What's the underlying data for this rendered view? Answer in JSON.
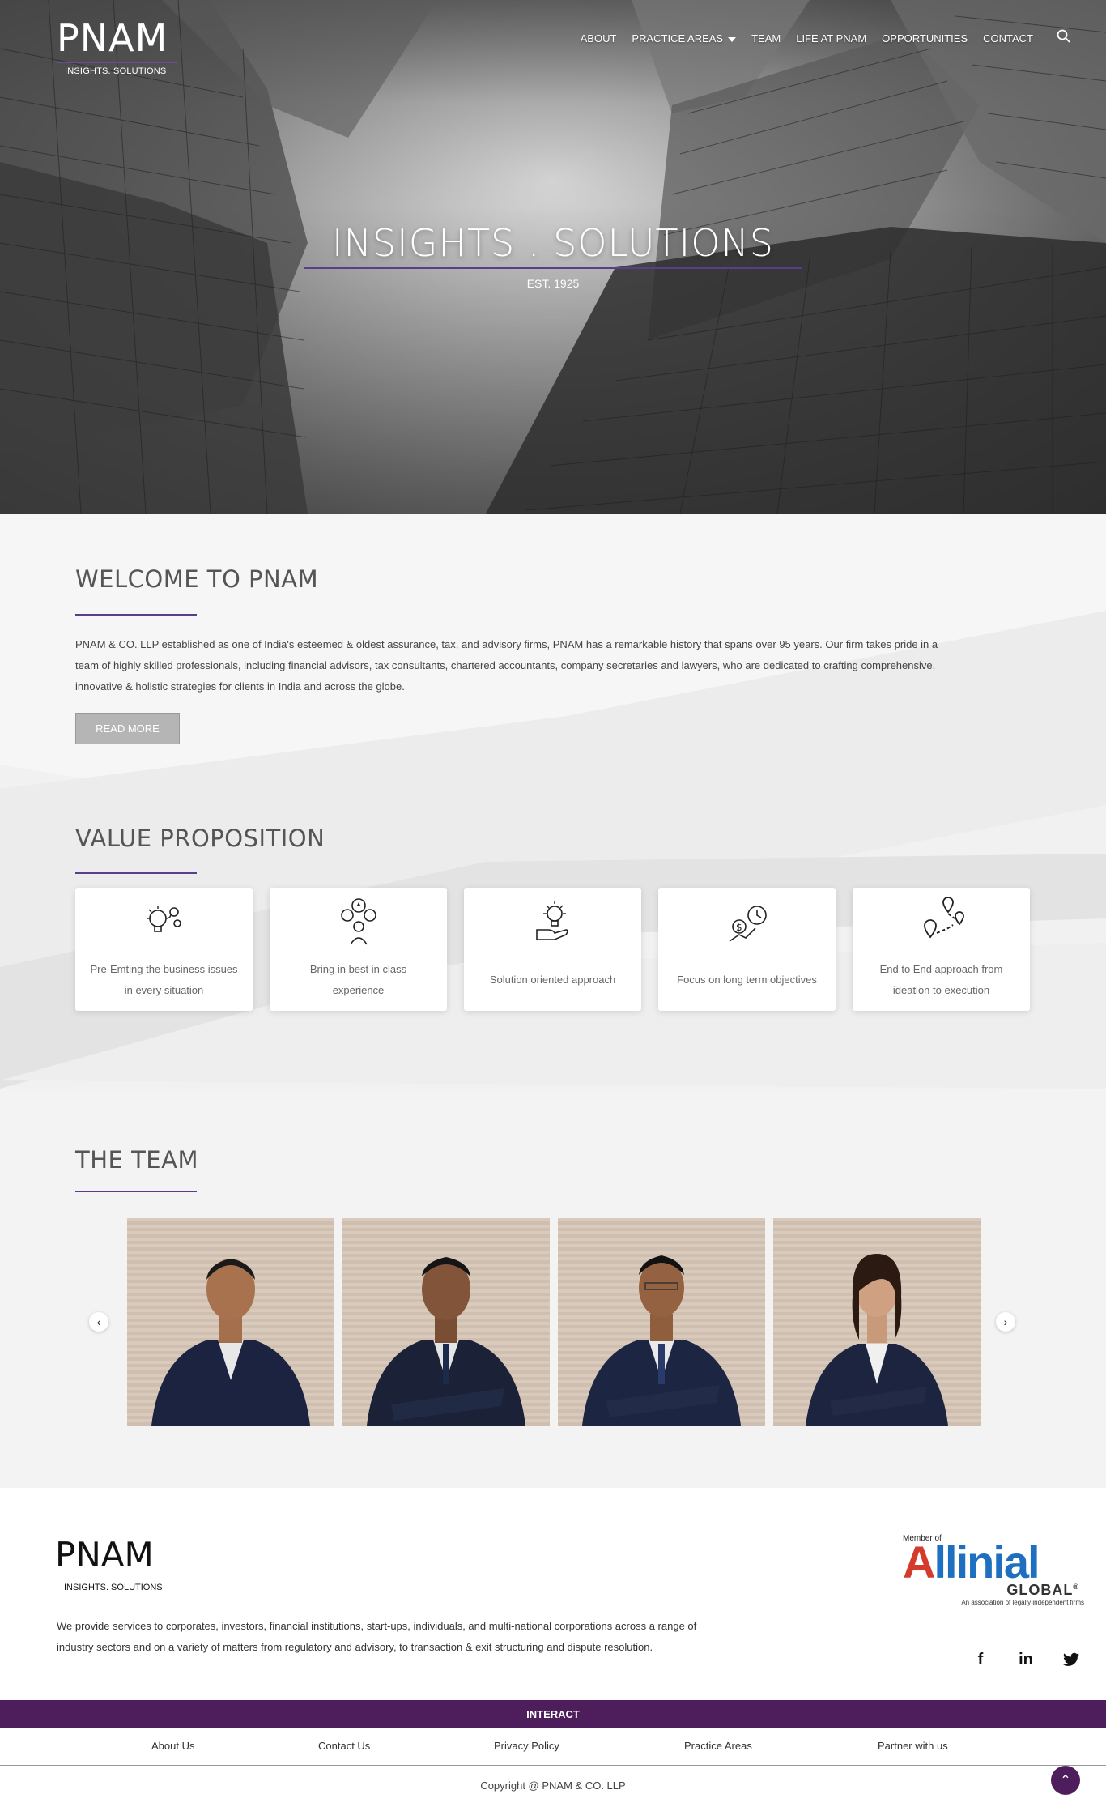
{
  "brand": {
    "logo": "PNAM",
    "tagline": "INSIGHTS. SOLUTIONS"
  },
  "nav": {
    "items": [
      "ABOUT",
      "PRACTICE AREAS",
      "TEAM",
      "LIFE AT PNAM",
      "OPPORTUNITIES",
      "CONTACT"
    ],
    "search_icon": "search-icon",
    "dropdown_icon": "chevron-down-icon"
  },
  "hero": {
    "title": "INSIGHTS . SOLUTIONS",
    "subtitle": "EST. 1925"
  },
  "welcome": {
    "title": "WELCOME TO PNAM",
    "body": "PNAM & CO. LLP established as one of India's esteemed & oldest assurance, tax, and advisory firms, PNAM has a remarkable history that spans over 95 years. Our firm takes pride in a team of highly skilled professionals, including financial advisors, tax consultants, chartered accountants, company secretaries and lawyers, who are dedicated to crafting comprehensive, innovative & holistic strategies for clients in India and across the globe.",
    "button": "READ MORE"
  },
  "values": {
    "title": "VALUE PROPOSITION",
    "cards": [
      {
        "icon": "lightbulb-gears-icon",
        "line1": "Pre-Emting the business issues",
        "line2": "in every situation"
      },
      {
        "icon": "best-in-class-icon",
        "line1": "Bring in best in class",
        "line2": "experience"
      },
      {
        "icon": "hand-lightbulb-icon",
        "line1": "Solution oriented approach",
        "line2": ""
      },
      {
        "icon": "money-clock-growth-icon",
        "line1": "Focus on long term objectives",
        "line2": ""
      },
      {
        "icon": "route-map-icon",
        "line1": "End to End approach from",
        "line2": "ideation to execution"
      }
    ]
  },
  "team": {
    "title": "THE TEAM",
    "prev": "‹",
    "next": "›",
    "member_count": 4
  },
  "footer": {
    "logo": "PNAM",
    "tagline": "INSIGHTS. SOLUTIONS",
    "description": "We provide services to corporates, investors, financial institutions, start-ups, individuals, and multi-national corporations across a range of industry sectors and on a variety of matters from regulatory and advisory, to transaction & exit structuring and dispute resolution.",
    "member_of": "Member of",
    "allinial": {
      "a": "A",
      "rest": "llinial",
      "global": "GLOBAL",
      "reg": "®",
      "assoc": "An association of legally independent firms"
    },
    "social": [
      {
        "icon": "facebook-icon",
        "glyph": "f"
      },
      {
        "icon": "linkedin-icon",
        "glyph": "in"
      },
      {
        "icon": "twitter-icon",
        "glyph": "🐦"
      }
    ],
    "interact": "INTERACT",
    "links": [
      "About Us",
      "Contact Us",
      "Privacy Policy",
      "Practice Areas",
      "Partner with us"
    ],
    "copyright": "Copyright @ PNAM & CO. LLP",
    "back_to_top": "⌃"
  },
  "colors": {
    "accent": "#5b3c8e",
    "footer_band": "#4e1d5c"
  }
}
